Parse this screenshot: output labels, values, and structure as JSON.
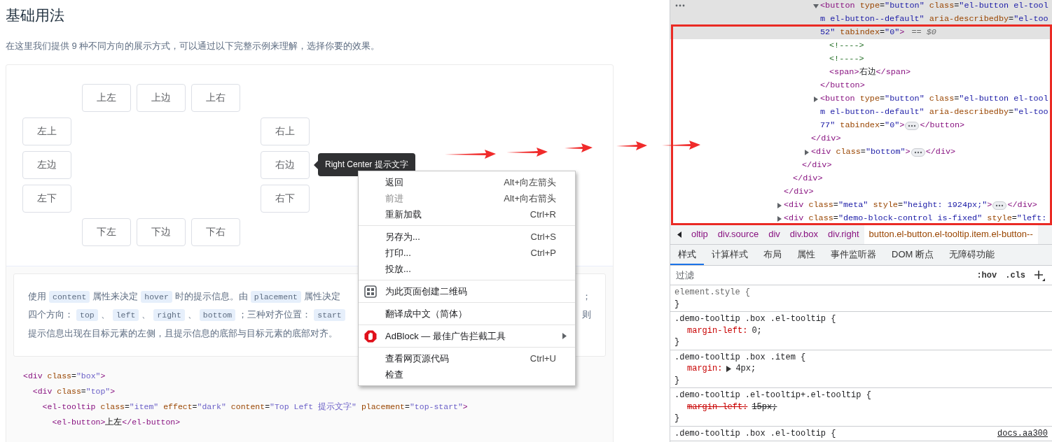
{
  "page": {
    "heading": "基础用法",
    "intro": "在这里我们提供 9 种不同方向的展示方式，可以通过以下完整示例来理解，选择你要的效果。"
  },
  "demo": {
    "buttons": {
      "top": [
        {
          "label": "上左"
        },
        {
          "label": "上边"
        },
        {
          "label": "上右"
        }
      ],
      "left": [
        {
          "label": "左上"
        },
        {
          "label": "左边"
        },
        {
          "label": "左下"
        }
      ],
      "right": [
        {
          "label": "右上"
        },
        {
          "label": "右边",
          "tooltip": "Right Center 提示文字"
        },
        {
          "label": "右下"
        }
      ],
      "bottom": [
        {
          "label": "下左"
        },
        {
          "label": "下边"
        },
        {
          "label": "下右"
        }
      ]
    },
    "description": [
      {
        "segments": [
          {
            "kind": "text",
            "text": "使用"
          },
          {
            "kind": "code",
            "text": "content"
          },
          {
            "kind": "text",
            "text": "属性来决定"
          },
          {
            "kind": "code",
            "text": "hover"
          },
          {
            "kind": "text",
            "text": "时的提示信息。由"
          },
          {
            "kind": "code",
            "text": "placement"
          },
          {
            "kind": "text",
            "text": "属性决定"
          }
        ],
        "tail": "；"
      },
      {
        "segments": [
          {
            "kind": "text",
            "text": "四个方向："
          },
          {
            "kind": "code",
            "text": "top"
          },
          {
            "kind": "text",
            "text": "、"
          },
          {
            "kind": "code",
            "text": "left"
          },
          {
            "kind": "text",
            "text": "、"
          },
          {
            "kind": "code",
            "text": "right"
          },
          {
            "kind": "text",
            "text": "、"
          },
          {
            "kind": "code",
            "text": "bottom"
          },
          {
            "kind": "text",
            "text": "；三种对齐位置："
          },
          {
            "kind": "code",
            "text": "start"
          }
        ],
        "tail": "则"
      },
      {
        "segments": [
          {
            "kind": "text",
            "text": "提示信息出现在目标元素的左侧，且提示信息的底部与目标元素的底部对齐。"
          }
        ]
      }
    ],
    "code": [
      "<div class=\"box\">",
      "  <div class=\"top\">",
      "    <el-tooltip class=\"item\" effect=\"dark\" content=\"Top Left 提示文字\" placement=\"top-start\">",
      "      <el-button>上左</el-button>"
    ]
  },
  "context_menu": {
    "groups": [
      [
        {
          "label": "返回",
          "shortcut": "Alt+向左箭头",
          "disabled": false,
          "has_submenu": false
        },
        {
          "label": "前进",
          "shortcut": "Alt+向右箭头",
          "disabled": true,
          "has_submenu": false
        },
        {
          "label": "重新加载",
          "shortcut": "Ctrl+R",
          "disabled": false,
          "has_submenu": false
        }
      ],
      [
        {
          "label": "另存为...",
          "shortcut": "Ctrl+S",
          "disabled": false,
          "has_submenu": false
        },
        {
          "label": "打印...",
          "shortcut": "Ctrl+P",
          "disabled": false,
          "has_submenu": false
        },
        {
          "label": "投放...",
          "disabled": false,
          "has_submenu": false
        }
      ],
      [
        {
          "label": "为此页面创建二维码",
          "kind": "qrcode",
          "disabled": false,
          "has_submenu": false
        }
      ],
      [
        {
          "label": "翻译成中文（简体）",
          "disabled": false,
          "has_submenu": false
        }
      ],
      [
        {
          "label": "AdBlock — 最佳广告拦截工具",
          "kind": "extension",
          "disabled": false,
          "has_submenu": true
        }
      ],
      [
        {
          "label": "查看网页源代码",
          "shortcut": "Ctrl+U",
          "disabled": false,
          "has_submenu": false
        },
        {
          "label": "检查",
          "disabled": false,
          "has_submenu": false
        }
      ]
    ]
  },
  "devtools": {
    "dom_tree": [
      {
        "expanded": true,
        "selected": false,
        "close": "</div>",
        "children": [
          {
            "expanded": true,
            "selected": false,
            "close": "</div>",
            "children": [
              {
                "expanded": true,
                "selected": false,
                "close": "</div>",
                "children": [
                  {
                    "expanded": true,
                    "selected": false,
                    "close": "</div>",
                    "children": [
                      {
                        "open": [
                          "<button type=\"button\" class=\"el-button el-tool",
                          "m el-button--default\" aria-describedby=\"el-too",
                          "52\" tabindex=\"0\">"
                        ],
                        "selected_marker": "== $0",
                        "expanded": true,
                        "selected": true,
                        "close": "</button>",
                        "children": [
                          {
                            "open": [
                              "<!---->"
                            ],
                            "selected": false
                          },
                          {
                            "open": [
                              "<!---->"
                            ],
                            "selected": false
                          },
                          {
                            "open": [
                              "<span>右边</span>"
                            ],
                            "selected": false
                          }
                        ]
                      },
                      {
                        "open": [
                          "<button type=\"button\" class=\"el-button el-tool",
                          "m el-button--default\" aria-describedby=\"el-too",
                          "77\" tabindex=\"0\">"
                        ],
                        "expanded": false,
                        "selected": false,
                        "close": "</button>"
                      }
                    ]
                  },
                  {
                    "open": [
                      "<div class=\"bottom\">"
                    ],
                    "expanded": false,
                    "selected": false,
                    "close": "</div>"
                  }
                ]
              }
            ]
          }
        ]
      },
      {
        "open": [
          "<div class=\"meta\" style=\"height: 1924px;\">"
        ],
        "expanded": false,
        "selected": false,
        "close": "</div>"
      },
      {
        "open": [
          "<div class=\"demo-block-control is-fixed\" style=\"left:"
        ],
        "expanded": false,
        "selected": false
      }
    ],
    "breadcrumbs": [
      {
        "label": "oltip",
        "selected": false
      },
      {
        "label": "div.source",
        "selected": false
      },
      {
        "label": "div",
        "selected": false
      },
      {
        "label": "div.box",
        "selected": false
      },
      {
        "label": "div.right",
        "selected": false
      },
      {
        "label": "button.el-button.el-tooltip.item.el-button--",
        "selected": true
      }
    ],
    "tabs": [
      {
        "label": "样式",
        "selected": true
      },
      {
        "label": "计算样式",
        "selected": false
      },
      {
        "label": "布局",
        "selected": false
      },
      {
        "label": "属性",
        "selected": false
      },
      {
        "label": "事件监听器",
        "selected": false
      },
      {
        "label": "DOM 断点",
        "selected": false
      },
      {
        "label": "无障碍功能",
        "selected": false
      }
    ],
    "filter": {
      "placeholder": "过滤"
    },
    "filter_buttons": [
      ":hov",
      ".cls"
    ],
    "style_rules": [
      {
        "kind": "inline",
        "selector": "element.style {",
        "close": "}"
      },
      {
        "kind": "rule",
        "selector": ".demo-tooltip .box .el-tooltip {",
        "declarations": [
          {
            "property": "margin-left:",
            "value": "0;",
            "overridden": false,
            "expandable": false
          }
        ],
        "close": "}"
      },
      {
        "kind": "rule",
        "selector": ".demo-tooltip .box .item {",
        "declarations": [
          {
            "property": "margin:",
            "value": "4px;",
            "overridden": false,
            "expandable": true
          }
        ],
        "close": "}"
      },
      {
        "kind": "rule",
        "selector": ".demo-tooltip .el-tooltip+.el-tooltip {",
        "declarations": [
          {
            "property": "margin-left:",
            "value": "15px;",
            "overridden": true,
            "expandable": false
          }
        ],
        "close": "}"
      },
      {
        "kind": "rule",
        "selector": ".demo-tooltip .box .el-tooltip {",
        "source": "docs.aa300"
      }
    ]
  }
}
